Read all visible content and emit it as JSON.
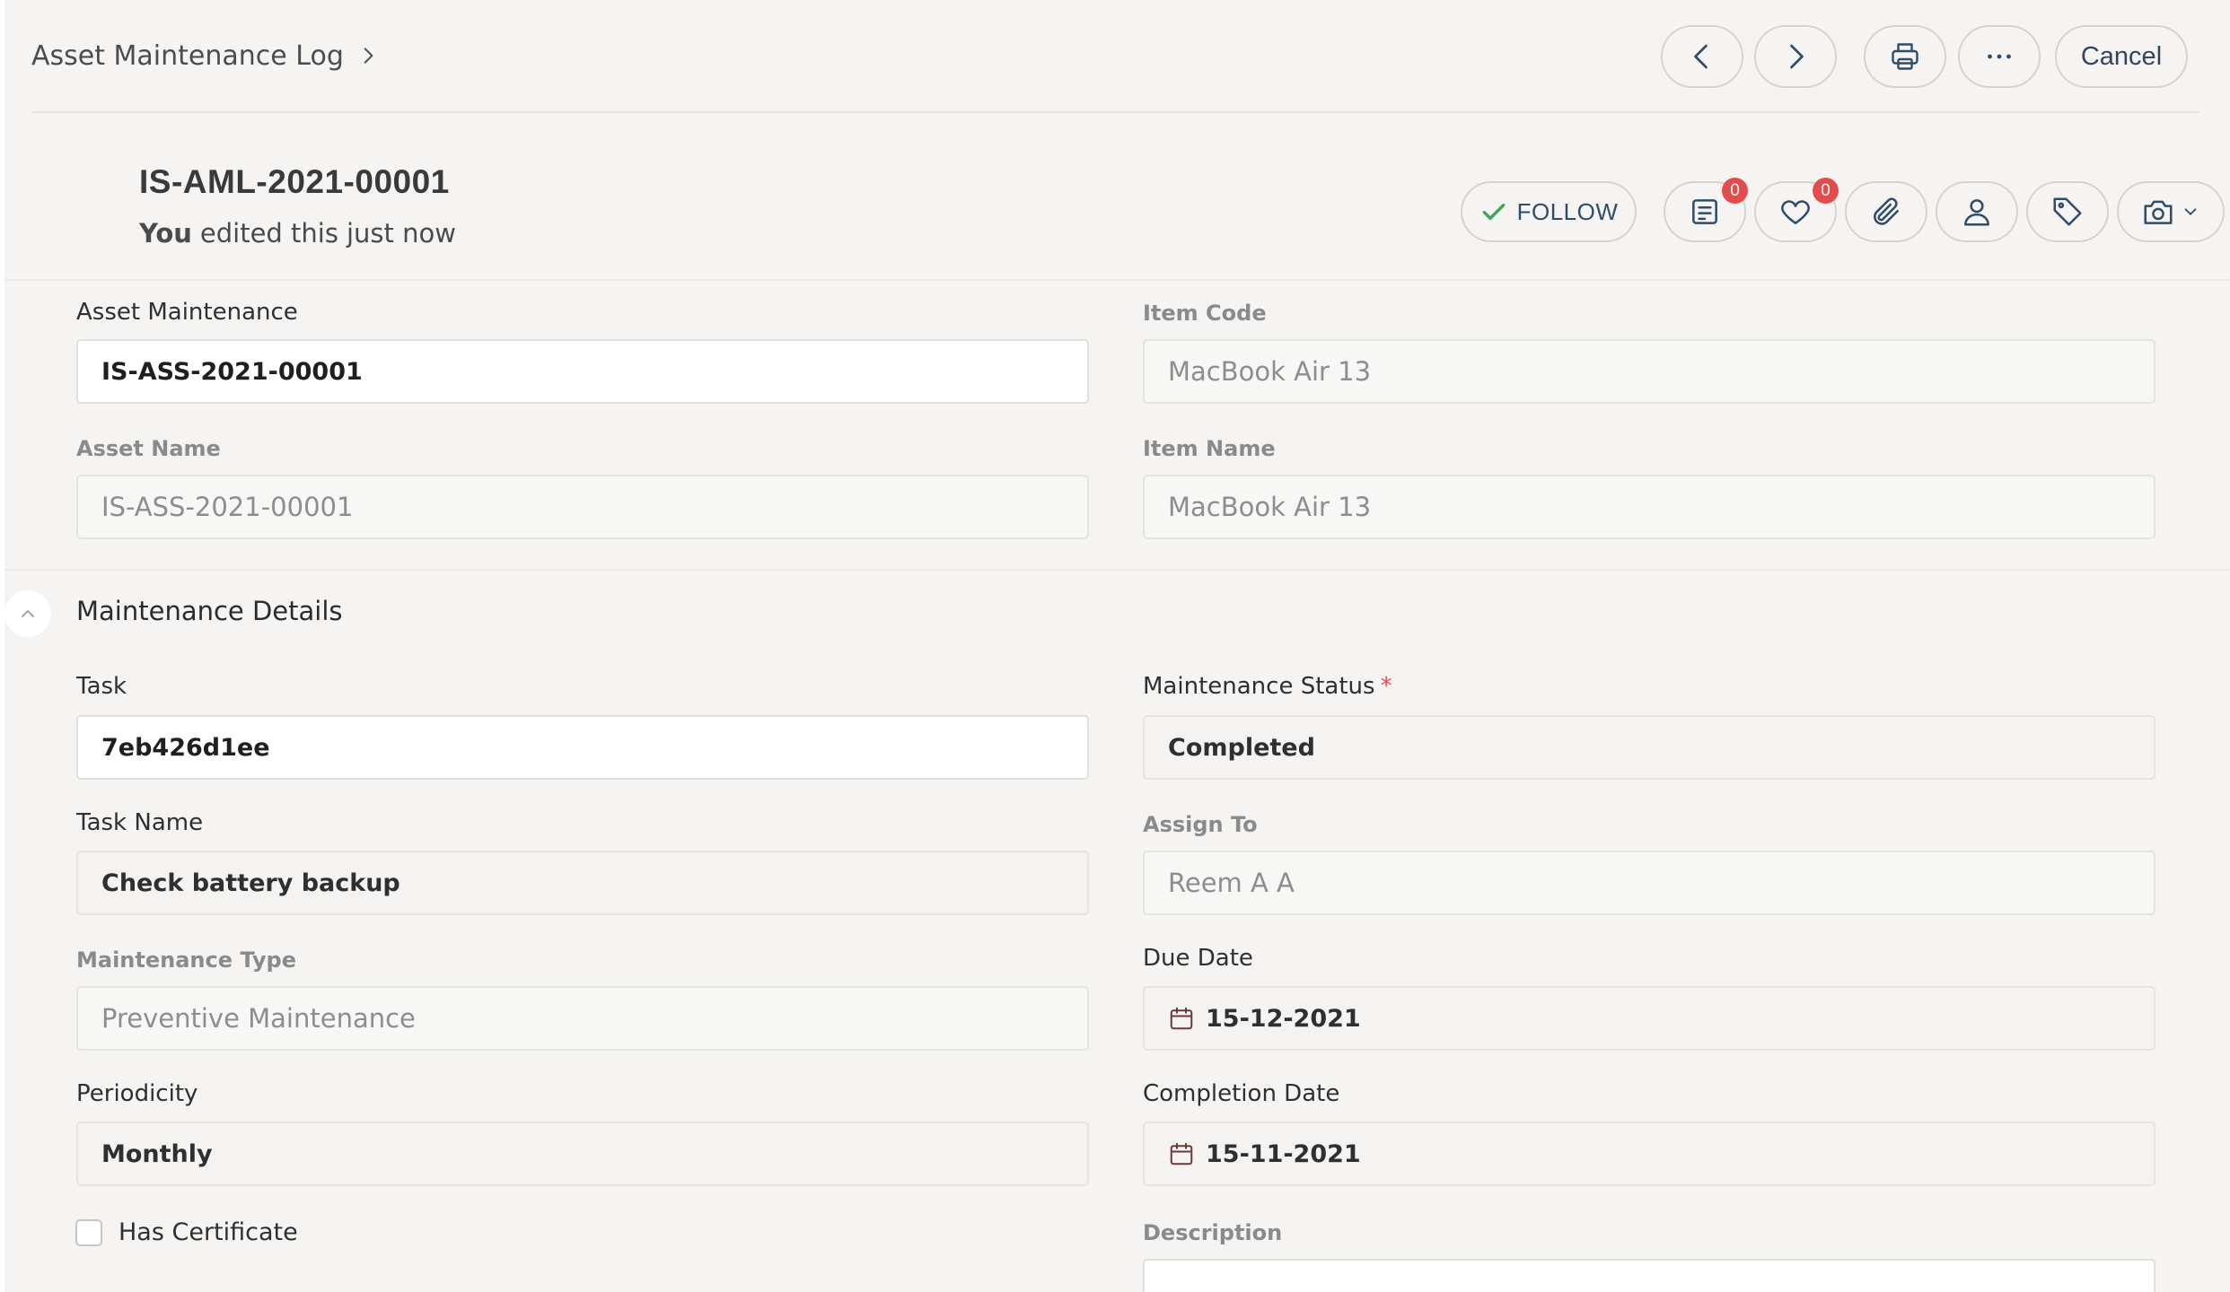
{
  "breadcrumb": {
    "label": "Asset Maintenance Log"
  },
  "toolbar": {
    "cancel_label": "Cancel"
  },
  "document": {
    "title": "IS-AML-2021-00001",
    "edited_by": "You",
    "edited_text": "edited this",
    "edited_time": "just now"
  },
  "actions": {
    "follow_label": "FOLLOW",
    "comments_count": "0",
    "likes_count": "0"
  },
  "fields": {
    "asset_maintenance": {
      "label": "Asset Maintenance",
      "value": "IS-ASS-2021-00001"
    },
    "item_code": {
      "label": "Item Code",
      "value": "MacBook Air 13"
    },
    "asset_name": {
      "label": "Asset Name",
      "value": "IS-ASS-2021-00001"
    },
    "item_name": {
      "label": "Item Name",
      "value": "MacBook Air 13"
    },
    "task": {
      "label": "Task",
      "value": "7eb426d1ee"
    },
    "maintenance_status": {
      "label": "Maintenance Status",
      "required_mark": "*",
      "value": "Completed"
    },
    "task_name": {
      "label": "Task Name",
      "value": "Check battery backup"
    },
    "assign_to": {
      "label": "Assign To",
      "value": "Reem A A"
    },
    "maintenance_type": {
      "label": "Maintenance Type",
      "value": "Preventive Maintenance"
    },
    "due_date": {
      "label": "Due Date",
      "value": "15-12-2021"
    },
    "periodicity": {
      "label": "Periodicity",
      "value": "Monthly"
    },
    "completion_date": {
      "label": "Completion Date",
      "value": "15-11-2021"
    },
    "has_certificate": {
      "label": "Has Certificate",
      "checked": false
    },
    "description": {
      "label": "Description",
      "value": ""
    }
  },
  "section": {
    "title": "Maintenance Details"
  },
  "colors": {
    "background": "#f5f4f2",
    "accent": "#2f4d69",
    "badge": "#e24c4b",
    "check": "#3aa55c"
  }
}
